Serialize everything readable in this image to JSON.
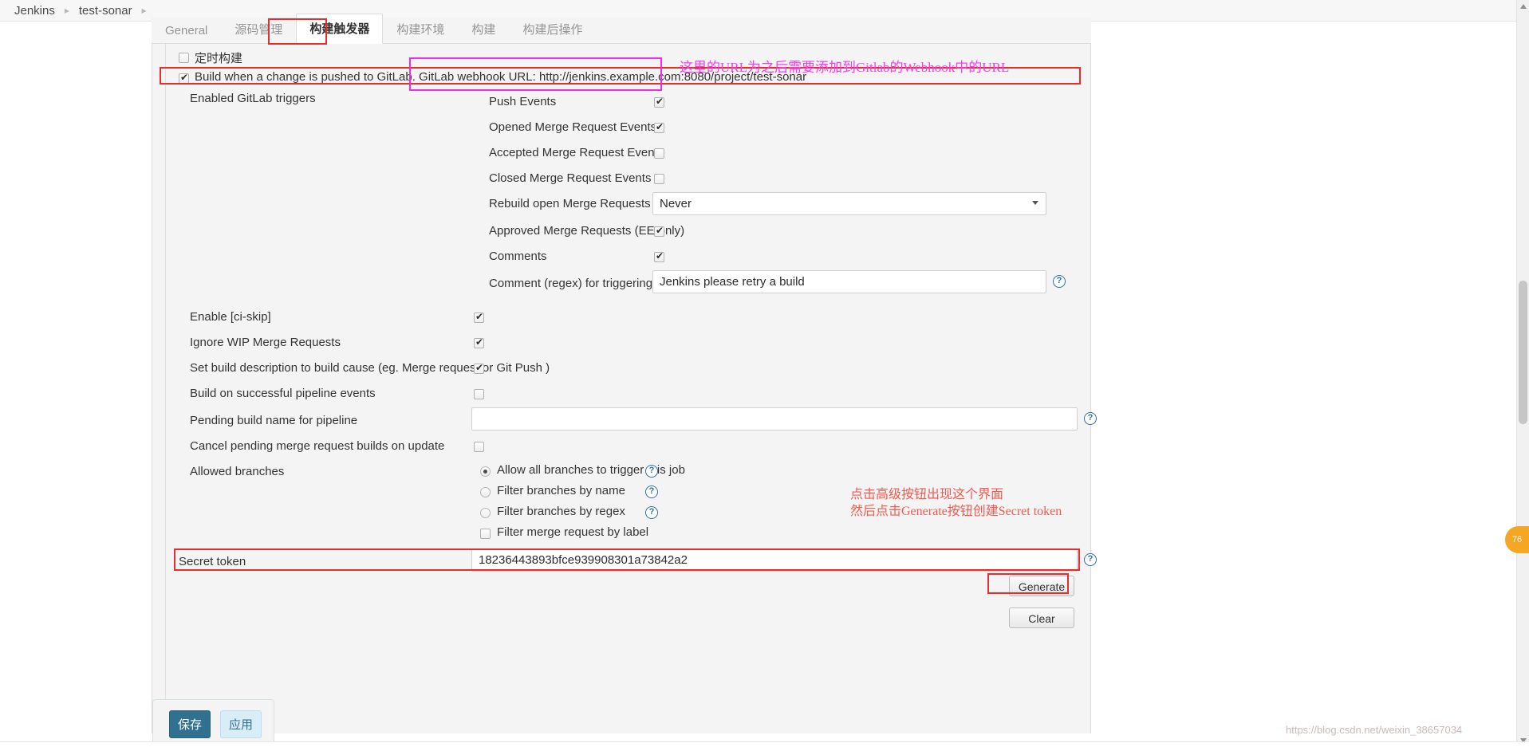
{
  "breadcrumb": {
    "items": [
      "Jenkins",
      "test-sonar",
      ""
    ],
    "separator": "▸"
  },
  "tabs": [
    {
      "label": "General",
      "active": false
    },
    {
      "label": "源码管理",
      "active": false
    },
    {
      "label": "构建触发器",
      "active": true
    },
    {
      "label": "构建环境",
      "active": false
    },
    {
      "label": "构建",
      "active": false
    },
    {
      "label": "构建后操作",
      "active": false
    }
  ],
  "triggers": {
    "timer_build_label": "定时构建",
    "timer_build_checked": false,
    "gitlab_label": "Build when a change is pushed to GitLab. GitLab webhook URL: http://jenkins.example.com:8080/project/test-sonar",
    "gitlab_checked": true,
    "enabled_triggers_label": "Enabled GitLab triggers",
    "events": [
      {
        "label": "Push Events",
        "checked": true
      },
      {
        "label": "Opened Merge Request Events",
        "checked": true
      },
      {
        "label": "Accepted Merge Request Events",
        "checked": false
      },
      {
        "label": "Closed Merge Request Events",
        "checked": false
      }
    ],
    "rebuild_label": "Rebuild open Merge Requests",
    "rebuild_value": "Never",
    "approved_label": "Approved Merge Requests (EE-only)",
    "approved_checked": true,
    "comments_label": "Comments",
    "comments_checked": true,
    "comment_regex_label": "Comment (regex) for triggering a build",
    "comment_regex_value": "Jenkins please retry a build",
    "options": [
      {
        "label": "Enable [ci-skip]",
        "checked": true
      },
      {
        "label": "Ignore WIP Merge Requests",
        "checked": true
      },
      {
        "label": "Set build description to build cause (eg. Merge request or Git Push )",
        "checked": true
      },
      {
        "label": "Build on successful pipeline events",
        "checked": false
      }
    ],
    "pending_build_label": "Pending build name for pipeline",
    "pending_build_value": "",
    "cancel_pending_label": "Cancel pending merge request builds on update",
    "cancel_pending_checked": false,
    "allowed_branches_label": "Allowed branches",
    "branch_radios": [
      {
        "label": "Allow all branches to trigger this job",
        "selected": true
      },
      {
        "label": "Filter branches by name",
        "selected": false
      },
      {
        "label": "Filter branches by regex",
        "selected": false
      }
    ],
    "filter_merge_label": "Filter merge request by label",
    "filter_merge_checked": false,
    "secret_token_label": "Secret token",
    "secret_token_value": "18236443893bfce939908301a73842a2",
    "generate_label": "Generate",
    "clear_label": "Clear"
  },
  "actions": {
    "save_label": "保存",
    "apply_label": "应用"
  },
  "annotations": {
    "webhook_note": "这里的URL为之后需要添加到Gitlab的Webhook中的URL",
    "secret_note_line1": "点击高级按钮出现这个界面",
    "secret_note_line2": "然后点击Generate按钮创建Secret token"
  },
  "misc": {
    "help_icon": "?",
    "watermark": "https://blog.csdn.net/weixin_38657034",
    "float_widget": "76"
  },
  "colors": {
    "annotation_red": "#ee2b2b",
    "annotation_magenta": "#ee2bee",
    "primary_button": "#31708f",
    "panel_bg": "#f4f4f4"
  }
}
